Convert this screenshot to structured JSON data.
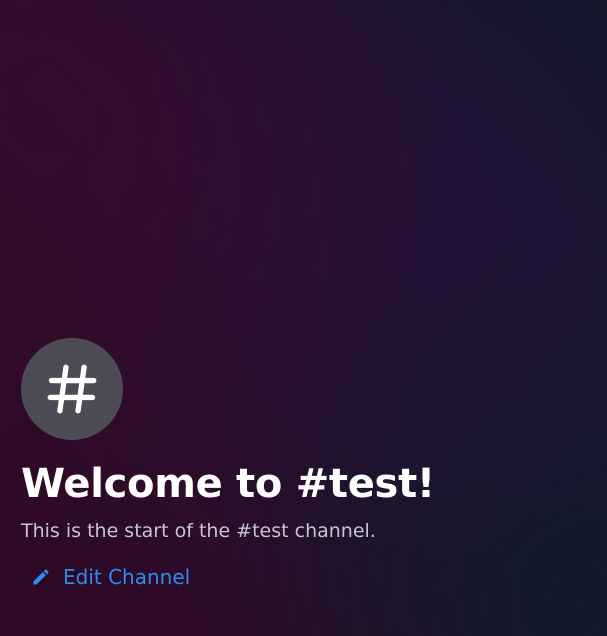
{
  "channel_intro": {
    "icon": "hashtag-icon",
    "title": "Welcome to #test!",
    "subtitle": "This is the start of the #test channel.",
    "edit_button": {
      "icon": "pencil-icon",
      "label": "Edit Channel"
    }
  },
  "colors": {
    "accent": "#2b8df2",
    "icon_bg": "#4b4c55",
    "title": "#ffffff",
    "subtitle": "#c6c5cf"
  }
}
